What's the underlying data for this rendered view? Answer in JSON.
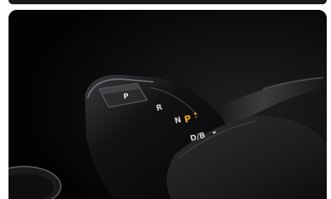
{
  "image": {
    "subject": "gear-selector",
    "gear_labels": {
      "park_button": "P",
      "reverse": "R",
      "neutral": "N",
      "park_indicator": "P",
      "drive": "D/B"
    },
    "colors": {
      "background": "#050505",
      "knob_gloss": "#1c1c1e",
      "leather": "#2a2a2c",
      "active_indicator": "#f2a62a",
      "label_white": "#e8e8e8"
    }
  }
}
